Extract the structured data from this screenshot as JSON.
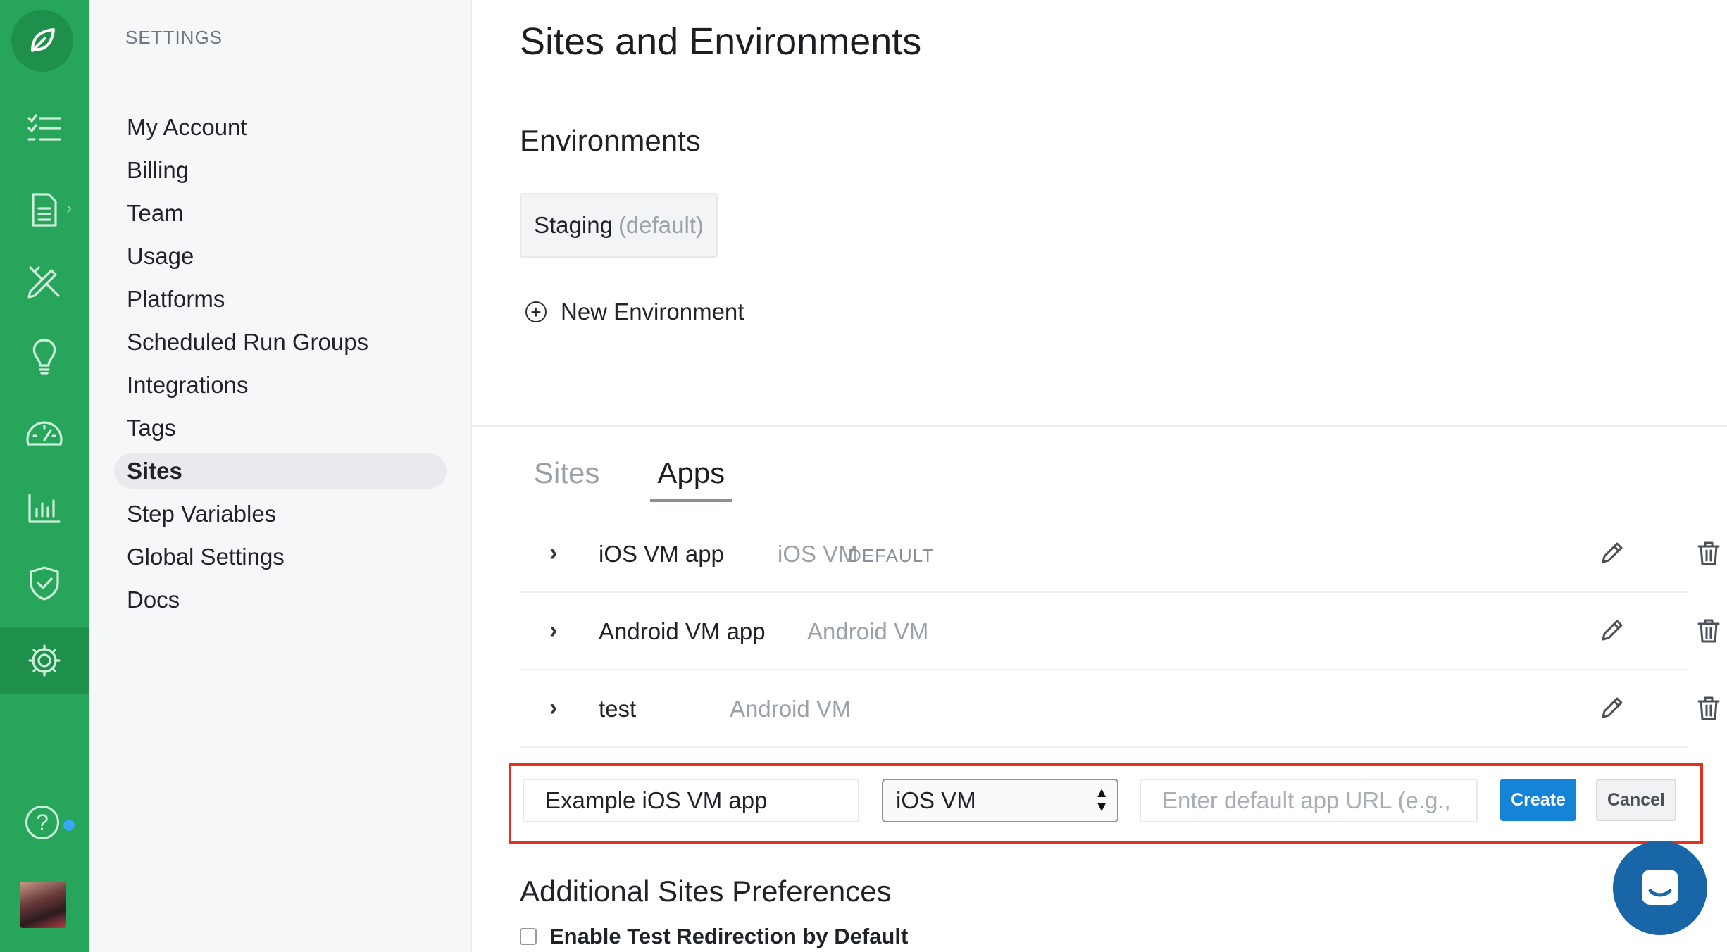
{
  "sidebar": {
    "heading": "SETTINGS",
    "items": [
      {
        "label": "My Account"
      },
      {
        "label": "Billing"
      },
      {
        "label": "Team"
      },
      {
        "label": "Usage"
      },
      {
        "label": "Platforms"
      },
      {
        "label": "Scheduled Run Groups"
      },
      {
        "label": "Integrations"
      },
      {
        "label": "Tags"
      },
      {
        "label": "Sites",
        "active": true
      },
      {
        "label": "Step Variables"
      },
      {
        "label": "Global Settings"
      },
      {
        "label": "Docs"
      }
    ]
  },
  "page": {
    "title": "Sites and Environments",
    "environments_title": "Environments",
    "env_chip_name": "Staging",
    "env_chip_default": "(default)",
    "new_environment": "New Environment"
  },
  "tabs": [
    {
      "label": "Sites",
      "active": false
    },
    {
      "label": "Apps",
      "active": true
    }
  ],
  "apps": [
    {
      "name": "iOS VM app",
      "platform": "iOS VM",
      "badge": "DEFAULT"
    },
    {
      "name": "Android VM app",
      "platform": "Android VM",
      "badge": ""
    },
    {
      "name": "test",
      "platform": "Android VM",
      "badge": ""
    }
  ],
  "new_app_form": {
    "name_value": "Example iOS VM app",
    "platform_value": "iOS VM",
    "url_placeholder": "Enter default app URL (e.g., h",
    "create_label": "Create",
    "cancel_label": "Cancel"
  },
  "additional": {
    "title": "Additional Sites Preferences",
    "checkbox_label": "Enable Test Redirection by Default"
  },
  "colors": {
    "rail": "#27a55b",
    "primary_button": "#1584d8",
    "highlight_border": "#e3321e",
    "chat_bubble": "#1866a8"
  }
}
